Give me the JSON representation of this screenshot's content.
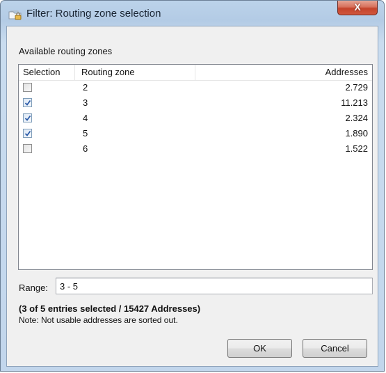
{
  "window": {
    "title": "Filter: Routing zone selection",
    "close_label": "X"
  },
  "group": {
    "label": "Available routing zones"
  },
  "table": {
    "columns": {
      "selection": "Selection",
      "zone": "Routing zone",
      "addresses": "Addresses"
    },
    "rows": [
      {
        "selected": false,
        "zone": "2",
        "addresses": "2.729"
      },
      {
        "selected": true,
        "zone": "3",
        "addresses": "11.213"
      },
      {
        "selected": true,
        "zone": "4",
        "addresses": "2.324"
      },
      {
        "selected": true,
        "zone": "5",
        "addresses": "1.890"
      },
      {
        "selected": false,
        "zone": "6",
        "addresses": "1.522"
      }
    ]
  },
  "range": {
    "label": "Range:",
    "value": "3 - 5"
  },
  "summary": "(3 of 5 entries selected / 15427 Addresses)",
  "note": "Note: Not usable addresses are sorted out.",
  "buttons": {
    "ok": "OK",
    "cancel": "Cancel"
  },
  "colors": {
    "frame": "#b9cfe8",
    "close_button": "#c9472f",
    "check_mark": "#2a5aa8"
  },
  "icons": {
    "title": "folder-filter-icon",
    "close": "close-icon",
    "check": "check-icon"
  }
}
